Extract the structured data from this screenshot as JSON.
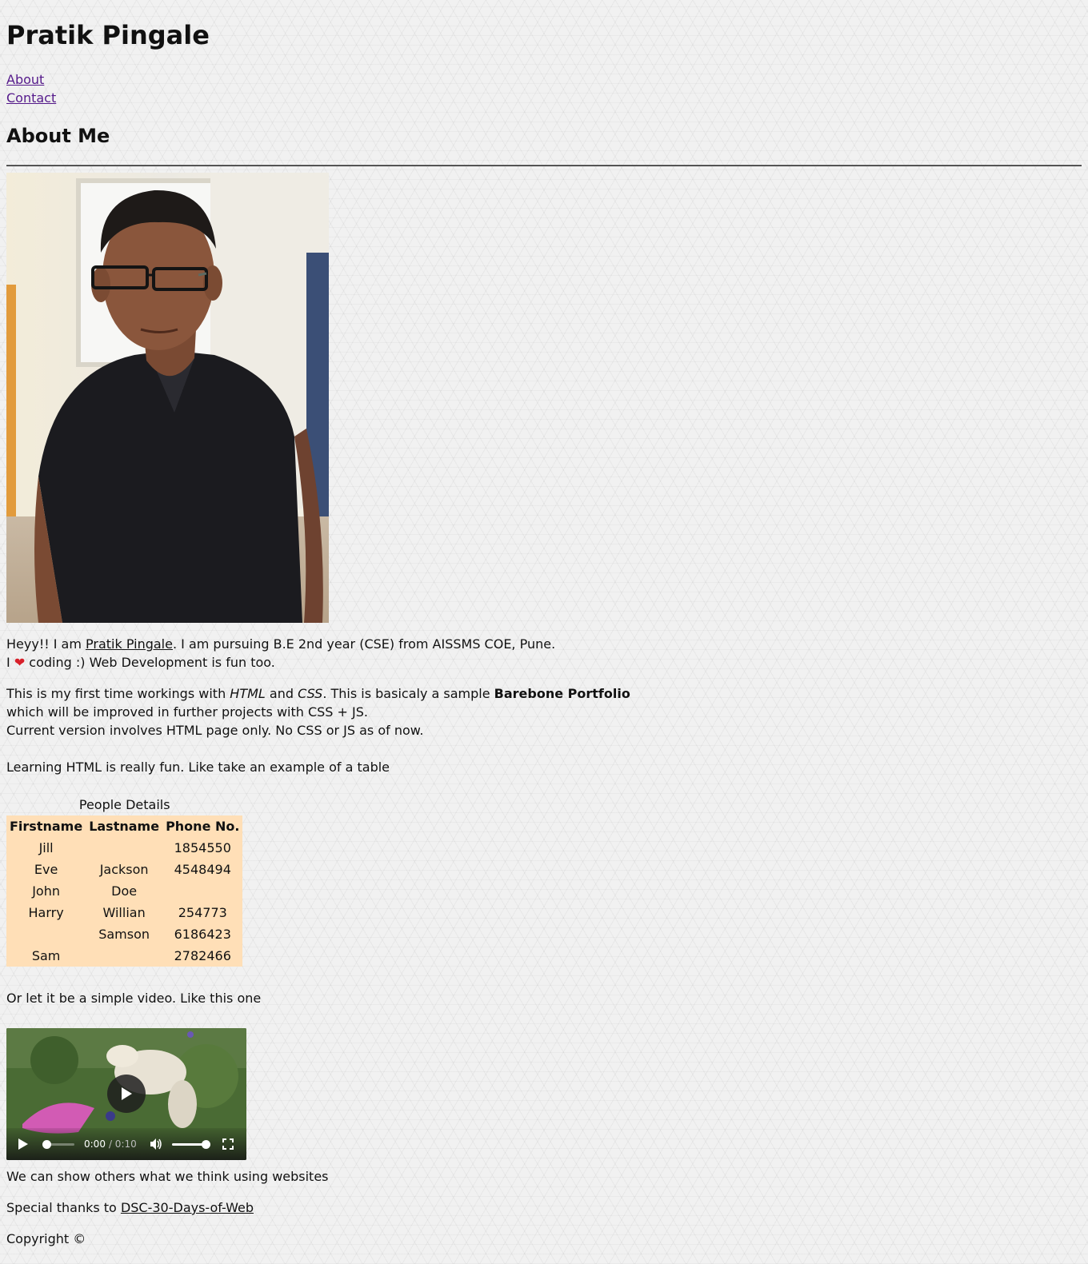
{
  "site": {
    "title": "Pratik Pingale"
  },
  "nav": {
    "items": [
      "About",
      "Contact"
    ]
  },
  "about": {
    "heading": "About Me",
    "intro_line1_before": "Heyy!! I am ",
    "intro_name_link": "Pratik Pingale",
    "intro_line1_after": ". I am pursuing B.E 2nd year (CSE) from AISSMS COE, Pune.",
    "intro_line2_before": "I ",
    "intro_line2_after": " coding :) Web Development is fun too.",
    "para_part1": "This is my first time workings with ",
    "para_html": "HTML",
    "para_and": " and ",
    "para_css": "CSS",
    "para_part2": ". This is basicaly a sample ",
    "para_bold": "Barebone Portfolio",
    "para_line2": "which will be improved in further projects with CSS + JS.",
    "para_line3": "Current version involves HTML page only. No CSS or JS as of now.",
    "table_intro": "Learning HTML is really fun. Like take an example of a table"
  },
  "table": {
    "caption": "People Details",
    "headers": [
      "Firstname",
      "Lastname",
      "Phone No."
    ],
    "rows": [
      [
        "Jill",
        "",
        "1854550"
      ],
      [
        "Eve",
        "Jackson",
        "4548494"
      ],
      [
        "John",
        "Doe",
        ""
      ],
      [
        "Harry",
        "Willian",
        "254773"
      ],
      [
        "",
        "Samson",
        "6186423"
      ],
      [
        "Sam",
        "",
        "2782466"
      ]
    ]
  },
  "video": {
    "intro": "Or let it be a simple video. Like this one",
    "current_time": "0:00",
    "duration": "/ 0:10",
    "progress": 0,
    "volume": 1
  },
  "footer": {
    "line1": "We can show others what we think using websites",
    "thanks_prefix": "Special thanks to ",
    "thanks_link": "DSC-30-Days-of-Web",
    "copyright": "Copyright ©"
  },
  "colors": {
    "link_visited": "#551a8b",
    "table_bg": "#ffdfb7",
    "heart": "#d8202a"
  },
  "icons": [
    "heart-icon",
    "play-icon",
    "volume-icon",
    "fullscreen-icon"
  ]
}
